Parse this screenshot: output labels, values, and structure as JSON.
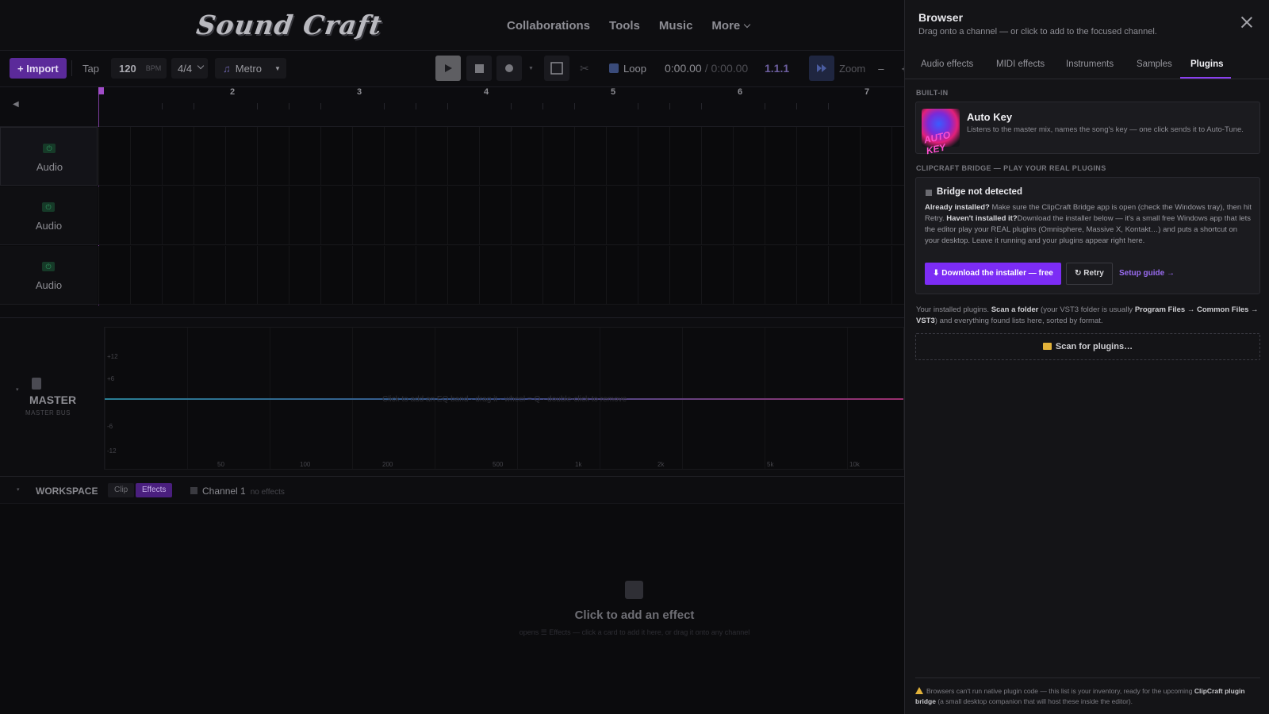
{
  "nav": {
    "logo": "Sound Craft",
    "links": [
      "Collaborations",
      "Tools",
      "Music",
      "More"
    ]
  },
  "toolbar": {
    "import": "+ Import",
    "tap": "Tap",
    "bpm": "120",
    "bpm_unit": "BPM",
    "time_sig": "4/4",
    "metro": "Metro",
    "loop": "Loop",
    "time_current": "0:00.00",
    "time_total": "/ 0:00.00",
    "position": "1.1.1",
    "zoom": "Zoom",
    "zoom_minus": "–",
    "zoom_plus": "+"
  },
  "ruler": {
    "bars": [
      "2",
      "3",
      "4",
      "5",
      "6",
      "7"
    ]
  },
  "tracks": [
    {
      "name": "Audio"
    },
    {
      "name": "Audio"
    },
    {
      "name": "Audio"
    }
  ],
  "master": {
    "name": "MASTER",
    "sub": "MASTER BUS",
    "eq_db": [
      "+12",
      "+6",
      "-6",
      "-12"
    ],
    "eq_hz": [
      "50",
      "100",
      "200",
      "500",
      "1k",
      "2k",
      "5k",
      "10k"
    ],
    "eq_hint": "Click to add an EQ band · drag it · wheel = Q · double-click to remove"
  },
  "workspace": {
    "title": "WORKSPACE",
    "tab_clip": "Clip",
    "tab_effects": "Effects",
    "channel": "Channel 1",
    "channel_note": "no effects",
    "empty_title": "Click to add an effect",
    "empty_sub": "opens ☰ Effects — click a card to add it here, or drag it onto any channel"
  },
  "browser": {
    "title": "Browser",
    "subtitle": "Drag onto a channel — or click to add to the focused channel.",
    "tabs": [
      "Audio effects",
      "MIDI effects",
      "Instruments",
      "Samples",
      "Plugins"
    ],
    "active_tab": "Plugins",
    "builtin_label": "BUILT-IN",
    "autokey": {
      "name": "Auto Key",
      "logo_text": "AUTO KEY",
      "desc": "Listens to the master mix, names the song's key — one click sends it to Auto-Tune."
    },
    "bridge_label": "CLIPCRAFT BRIDGE — PLAY YOUR REAL PLUGINS",
    "bridge": {
      "status": "Bridge not detected",
      "already_bold": "Already installed?",
      "already_text": " Make sure the ClipCraft Bridge app is open (check the Windows tray), then hit Retry. ",
      "havent_bold": "Haven't installed it?",
      "havent_text": "Download the installer below — it's a small free Windows app that lets the editor play your REAL plugins (Omnisphere, Massive X, Kontakt…) and puts a shortcut on your desktop. Leave it running and your plugins appear right here.",
      "download": "⬇ Download the installer — free",
      "retry": "↻ Retry",
      "guide": "Setup guide →"
    },
    "installed_pre": "Your installed plugins. ",
    "installed_bold1": "Scan a folder",
    "installed_mid": " (your VST3 folder is usually ",
    "installed_bold2": "Program Files → Common Files → VST3",
    "installed_post": ") and everything found lists here, sorted by format.",
    "scan": "Scan for plugins…",
    "footer_pre": "Browsers can't run native plugin code — this list is your inventory, ready for the upcoming ",
    "footer_bold": "ClipCraft plugin bridge",
    "footer_post": " (a small desktop companion that will host these inside the editor)."
  }
}
